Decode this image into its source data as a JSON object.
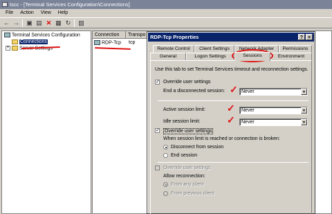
{
  "window": {
    "title": "tscc - [Terminal Services Configuration\\Connections]"
  },
  "menu": [
    "File",
    "Action",
    "View",
    "Help"
  ],
  "toolbar": {
    "icons": [
      "back-icon",
      "forward-icon",
      "up-icon",
      "delete-icon",
      "properties-icon",
      "refresh-icon",
      "export-icon",
      "help-icon"
    ]
  },
  "tree": {
    "root": "Terminal Services Configuration",
    "items": [
      {
        "label": "Connections",
        "selected": true
      },
      {
        "label": "Server Settings",
        "selected": false
      }
    ]
  },
  "list": {
    "columns": [
      "Connection",
      "Transpo"
    ],
    "rows": [
      {
        "connection": "RDP-Tcp",
        "transport": "tcp"
      }
    ]
  },
  "dialog": {
    "title": "RDP-Tcp Properties",
    "tabs_row1": [
      "Remote Control",
      "Client Settings",
      "Network Adapter",
      "Permissions"
    ],
    "tabs_row2": [
      "General",
      "Logon Settings",
      "Sessions",
      "Environment"
    ],
    "active_tab": "Sessions",
    "description": "Use this tab to set Terminal Services timeout and reconnection settings.",
    "override_1": {
      "label": "Override user settings",
      "checked": true
    },
    "end_disconnected": {
      "label": "End a disconnected session:",
      "value": "Never"
    },
    "active_limit": {
      "label": "Active session limit:",
      "value": "Never"
    },
    "idle_limit": {
      "label": "Idle session limit:",
      "value": "Never"
    },
    "override_2": {
      "label": "Override user settings",
      "checked": true
    },
    "broken_text": "When session limit is reached or connection is broken:",
    "radio_disconnect": {
      "label": "Disconnect from session",
      "selected": true
    },
    "radio_end": {
      "label": "End session",
      "selected": false
    },
    "override_3": {
      "label": "Override user settings",
      "checked": false
    },
    "allow_reconnect": "Allow reconnection:",
    "radio_any": {
      "label": "From any client",
      "selected": true
    },
    "radio_previous": {
      "label": "From previous client",
      "selected": false
    }
  },
  "colors": {
    "highlight": "#0a246a",
    "annotation": "#e01010",
    "titlebar_inactive": "#7a8398"
  }
}
